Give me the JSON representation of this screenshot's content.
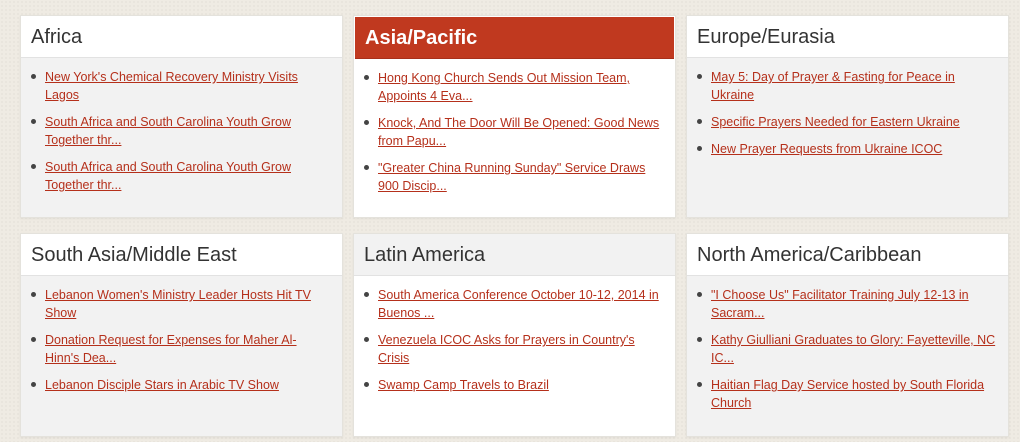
{
  "regions": [
    {
      "title": "Africa",
      "links": [
        "New York's Chemical Recovery Ministry Visits Lagos",
        "South Africa and South Carolina Youth Grow Together thr...",
        "South Africa and South Carolina Youth Grow Together thr..."
      ]
    },
    {
      "title": "Asia/Pacific",
      "links": [
        "Hong Kong Church Sends Out Mission Team, Appoints 4 Eva...",
        "Knock, And The Door Will Be Opened: Good News from Papu...",
        "\"Greater China Running Sunday\" Service Draws 900 Discip..."
      ]
    },
    {
      "title": "Europe/Eurasia",
      "links": [
        "May 5: Day of Prayer & Fasting for Peace in Ukraine",
        "Specific Prayers Needed for Eastern Ukraine",
        "New Prayer Requests from Ukraine ICOC"
      ]
    },
    {
      "title": "South Asia/Middle East",
      "links": [
        "Lebanon Women's Ministry Leader Hosts Hit TV Show",
        "Donation Request for Expenses for Maher Al-Hinn's Dea...",
        "Lebanon Disciple Stars in Arabic TV Show"
      ]
    },
    {
      "title": "Latin America",
      "links": [
        "South America Conference October 10-12, 2014 in Buenos ...",
        "Venezuela ICOC Asks for Prayers in Country's Crisis",
        "Swamp Camp Travels to Brazil"
      ]
    },
    {
      "title": "North America/Caribbean",
      "links": [
        "\"I Choose Us\" Facilitator Training July 12-13 in Sacram...",
        "Kathy Giulliani Graduates to Glory: Fayetteville, NC IC...",
        "Haitian Flag Day Service hosted by South Florida Church"
      ]
    }
  ],
  "colors": {
    "accent": "#c0391f",
    "link": "#b5301b",
    "page_background": "#efebe3"
  }
}
